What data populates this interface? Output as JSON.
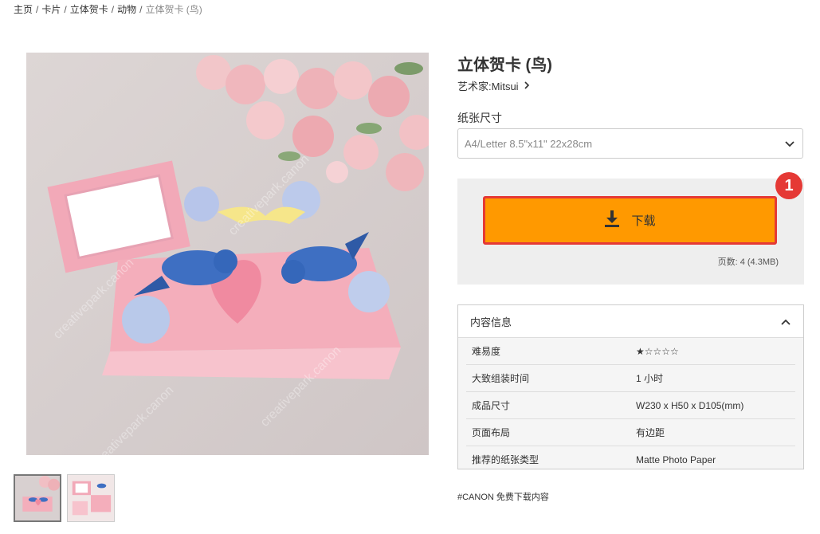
{
  "breadcrumb": {
    "items": [
      "主页",
      "卡片",
      "立体贺卡",
      "动物"
    ],
    "current": "立体贺卡 (鸟)",
    "separator": "/"
  },
  "product": {
    "title": "立体贺卡 (鸟)",
    "artist": "艺术家:Mitsui"
  },
  "paper": {
    "label": "纸张尺寸",
    "selected": "A4/Letter 8.5\"x11\" 22x28cm"
  },
  "download": {
    "label": "下载",
    "badge": "1",
    "page_info": "页数: 4 (4.3MB)"
  },
  "info": {
    "title": "内容信息",
    "rows": [
      {
        "key": "难易度",
        "value": "★☆☆☆☆"
      },
      {
        "key": "大致组装时间",
        "value": "1 小时"
      },
      {
        "key": "成品尺寸",
        "value": "W230 x H50 x D105(mm)"
      },
      {
        "key": "页面布局",
        "value": "有边距"
      },
      {
        "key": "推荐的纸张类型",
        "value": "Matte Photo Paper"
      }
    ]
  },
  "tags": "#CANON 免费下载内容",
  "colors": {
    "accent": "#ff9900",
    "highlight": "#e53935",
    "panel": "#eeeeee"
  },
  "icons": {
    "download": "download-icon",
    "artist_chevron": "chevron-right-icon",
    "select_chevron": "chevron-down-icon",
    "info_chevron": "chevron-up-icon"
  }
}
